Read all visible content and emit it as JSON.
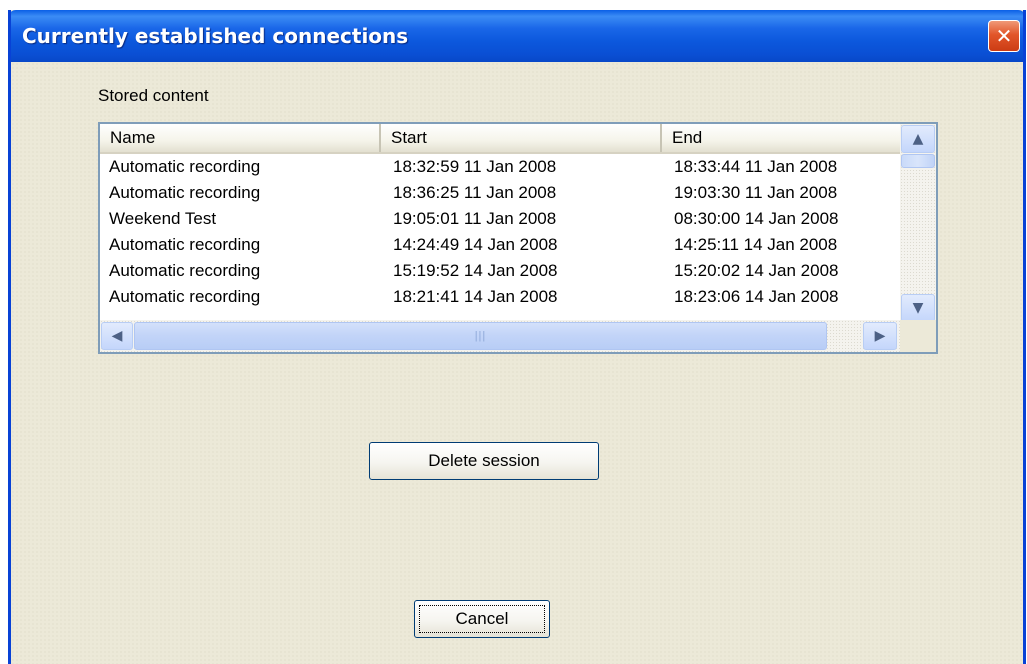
{
  "window": {
    "title": "Currently established connections",
    "close_glyph": "✕"
  },
  "stored_content": {
    "label": "Stored content",
    "columns": [
      "Name",
      "Start",
      "End"
    ],
    "rows": [
      [
        "Automatic recording",
        "18:32:59 11 Jan 2008",
        "18:33:44 11 Jan 2008"
      ],
      [
        "Automatic recording",
        "18:36:25 11 Jan 2008",
        "19:03:30 11 Jan 2008"
      ],
      [
        "Weekend Test",
        "19:05:01 11 Jan 2008",
        "08:30:00 14 Jan 2008"
      ],
      [
        "Automatic recording",
        "14:24:49 14 Jan 2008",
        "14:25:11 14 Jan 2008"
      ],
      [
        "Automatic recording",
        "15:19:52 14 Jan 2008",
        "15:20:02 14 Jan 2008"
      ],
      [
        "Automatic recording",
        "18:21:41 14 Jan 2008",
        "18:23:06 14 Jan 2008"
      ]
    ],
    "scroll": {
      "up_glyph": "▲",
      "down_glyph": "▼",
      "left_glyph": "◀",
      "right_glyph": "▶",
      "grip": "|||"
    }
  },
  "buttons": {
    "delete_session": "Delete session",
    "cancel": "Cancel"
  },
  "colors": {
    "title_bar": "#0a5fe6",
    "close_button": "#e2562a",
    "dialog_bg": "#ece9d8"
  }
}
